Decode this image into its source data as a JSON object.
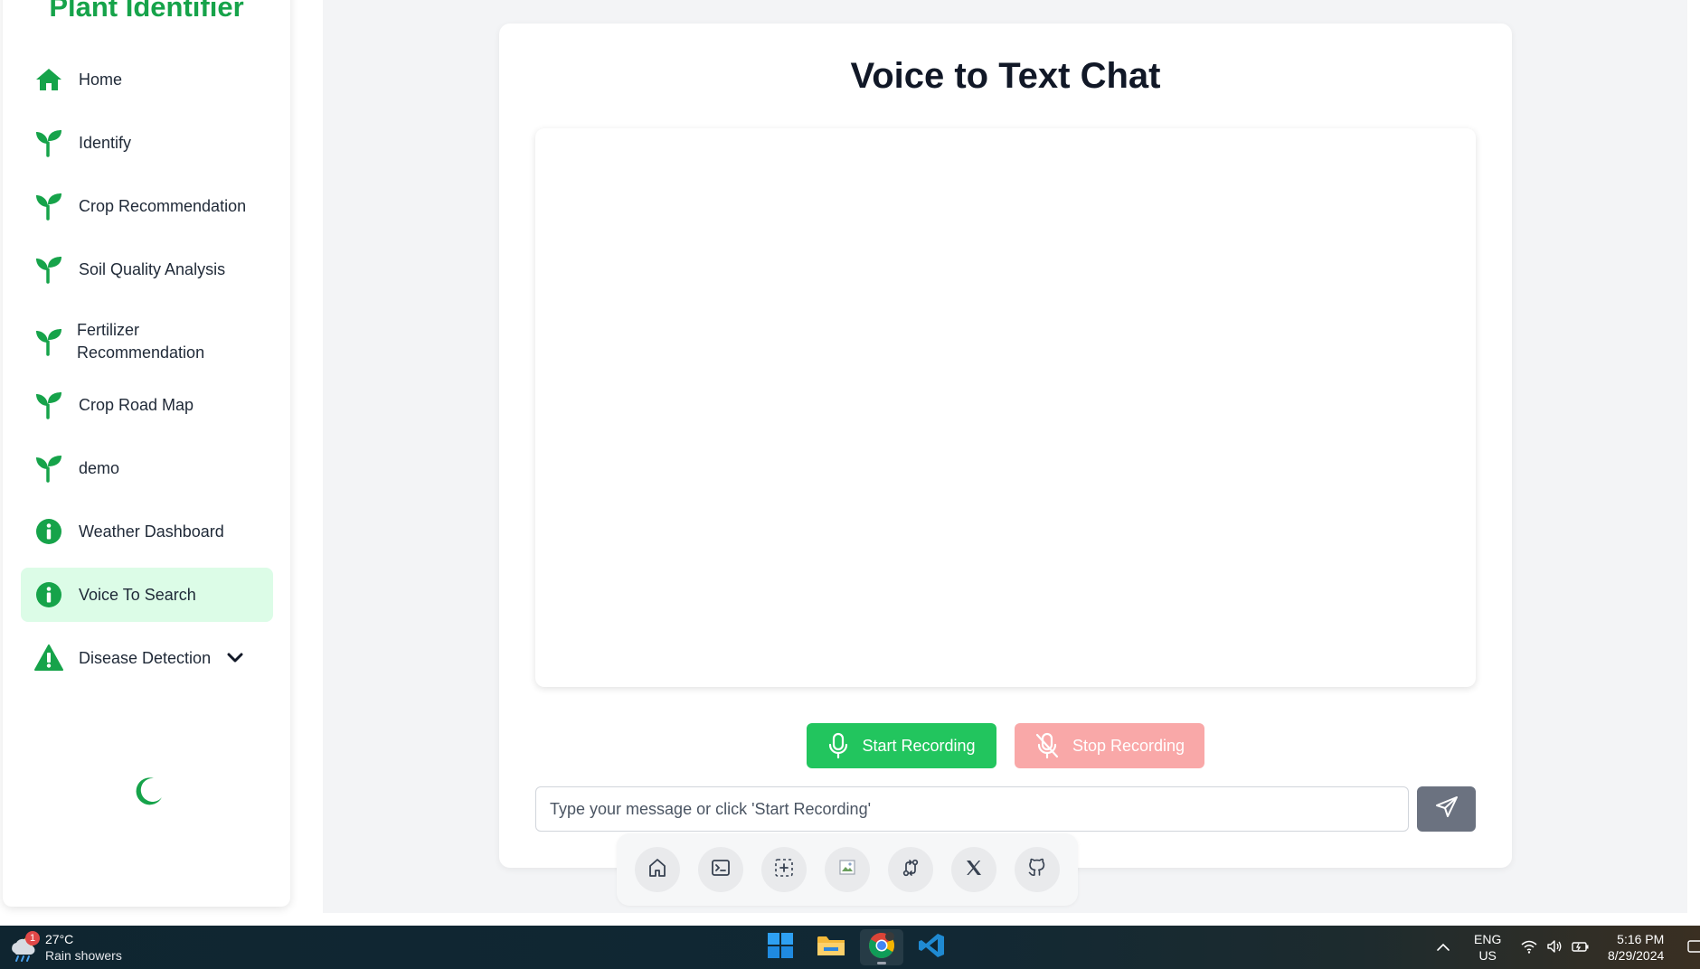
{
  "app": {
    "brand": "Plant Identifier"
  },
  "sidebar": {
    "items": [
      {
        "label": "Home",
        "icon": "home-icon"
      },
      {
        "label": "Identify",
        "icon": "sprout-icon"
      },
      {
        "label": "Crop Recommendation",
        "icon": "sprout-icon"
      },
      {
        "label": "Soil Quality Analysis",
        "icon": "sprout-icon"
      },
      {
        "label": "Fertilizer Recommendation",
        "icon": "sprout-icon"
      },
      {
        "label": "Crop Road Map",
        "icon": "sprout-icon"
      },
      {
        "label": "demo",
        "icon": "sprout-icon"
      },
      {
        "label": "Weather Dashboard",
        "icon": "info-icon"
      },
      {
        "label": "Voice To Search",
        "icon": "info-icon",
        "active": true
      },
      {
        "label": "Disease Detection",
        "icon": "warning-icon",
        "expandable": true
      }
    ],
    "theme_toggle_icon": "moon-icon"
  },
  "chat": {
    "title": "Voice to Text Chat",
    "start_label": "Start Recording",
    "stop_label": "Stop Recording",
    "input_placeholder": "Type your message or click 'Start Recording'",
    "input_value": "",
    "send_icon": "send-icon"
  },
  "dock": {
    "items": [
      "home-icon",
      "terminal-icon",
      "screenshot-icon",
      "broken-image-icon",
      "git-compare-icon",
      "x-logo-icon",
      "github-icon"
    ]
  },
  "taskbar": {
    "weather_badge": "1",
    "temperature": "27°C",
    "condition": "Rain showers",
    "lang_line1": "ENG",
    "lang_line2": "US",
    "time": "5:16 PM",
    "date": "8/29/2024"
  },
  "colors": {
    "brand_green": "#16a34a",
    "start_button": "#22c55e",
    "stop_button": "#f9a8a8",
    "active_nav_bg": "#dcfce7",
    "send_button": "#6b7280"
  }
}
